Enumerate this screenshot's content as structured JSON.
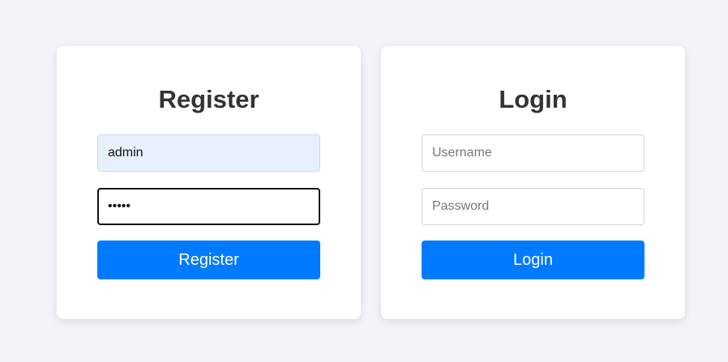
{
  "register": {
    "title": "Register",
    "username_value": "admin",
    "password_value": "•••••",
    "button_label": "Register"
  },
  "login": {
    "title": "Login",
    "username_placeholder": "Username",
    "password_placeholder": "Password",
    "button_label": "Login"
  },
  "colors": {
    "background": "#f3f3f8",
    "card": "#ffffff",
    "title": "#333333",
    "button": "#007bff",
    "button_text": "#ffffff",
    "autofill": "#e8f0fd"
  }
}
